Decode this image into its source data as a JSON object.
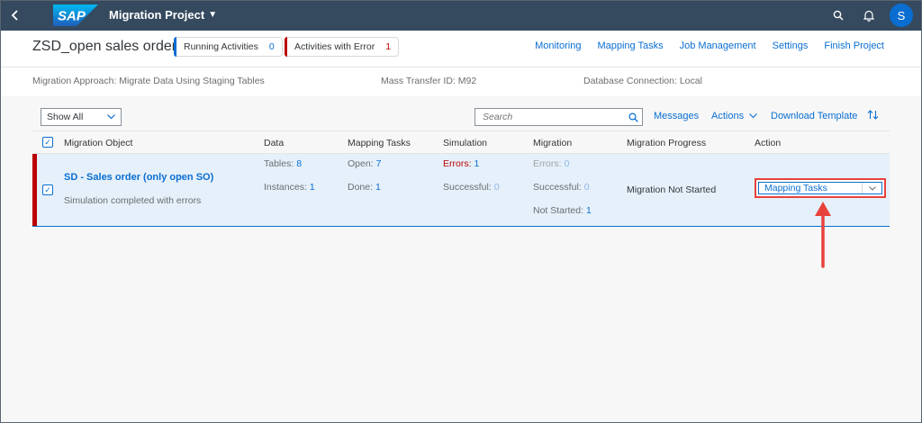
{
  "shell": {
    "logo_text": "SAP",
    "app_title": "Migration Project",
    "avatar_initial": "S"
  },
  "header": {
    "title": "ZSD_open sales order",
    "running_label": "Running Activities",
    "running_count": "0",
    "error_label": "Activities with Error",
    "error_count": "1",
    "nav": [
      "Monitoring",
      "Mapping Tasks",
      "Job Management",
      "Settings",
      "Finish Project"
    ],
    "migration_approach": "Migration Approach: Migrate Data Using Staging Tables",
    "mass_transfer": "Mass Transfer ID: M92",
    "db_connection": "Database Connection: Local"
  },
  "toolbar": {
    "filter_value": "Show All",
    "search_placeholder": "Search",
    "messages": "Messages",
    "actions": "Actions",
    "download": "Download Template"
  },
  "table": {
    "columns": [
      "Migration Object",
      "Data",
      "Mapping Tasks",
      "Simulation",
      "Migration",
      "Migration Progress",
      "Action"
    ],
    "row": {
      "object_name": "SD - Sales order (only open SO)",
      "object_status": "Simulation completed with errors",
      "tables_label": "Tables:",
      "tables_value": "8",
      "instances_label": "Instances:",
      "instances_value": "1",
      "open_label": "Open:",
      "open_value": "7",
      "done_label": "Done:",
      "done_value": "1",
      "sim_errors_label": "Errors:",
      "sim_errors_value": "1",
      "sim_success_label": "Successful:",
      "sim_success_value": "0",
      "mig_errors_label": "Errors:",
      "mig_errors_value": "0",
      "mig_success_label": "Successful:",
      "mig_success_value": "0",
      "mig_notstarted_label": "Not Started:",
      "mig_notstarted_value": "1",
      "progress": "Migration Not Started",
      "action_value": "Mapping Tasks"
    }
  },
  "colors": {
    "shell": "#354a5f",
    "brand_blue": "#0a6ed1",
    "error_red": "#bb0000",
    "annotation_red": "#e8423c"
  },
  "icons": [
    "back-icon",
    "search-icon",
    "bell-icon",
    "chevron-down-icon",
    "sort-icon",
    "checkbox-checked-icon"
  ]
}
